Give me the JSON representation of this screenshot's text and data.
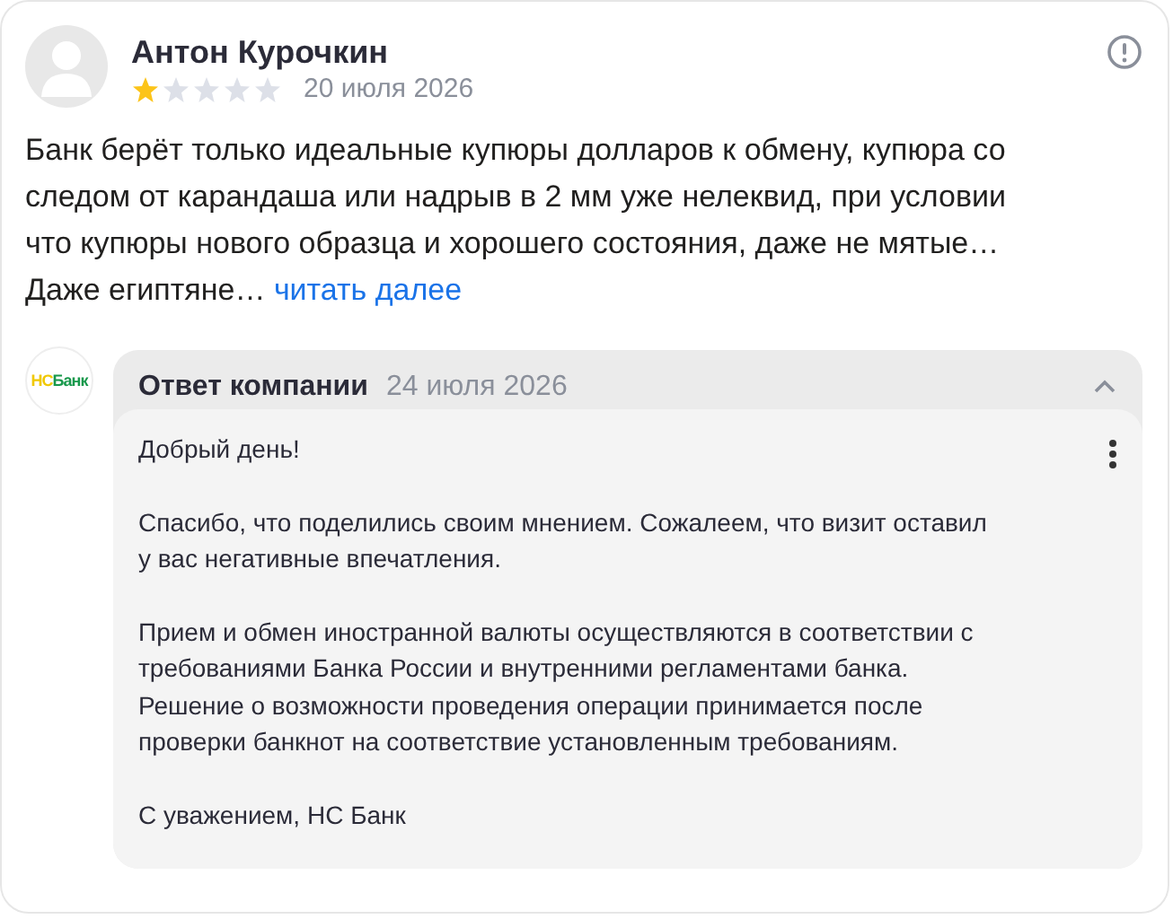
{
  "review": {
    "author": "Антон Курочкин",
    "stars": 1,
    "date": "20 июля 2026",
    "text": "Банк берёт только идеальные купюры долларов к обмену, купюра со\nследом от карандаша или надрыв в 2 мм уже нелеквид, при условии\nчто купюры нового образца и хорошего состояния, даже не мятые…\nДаже египтяне…",
    "more_link": "читать далее"
  },
  "reply": {
    "logo": {
      "part_1": "НС",
      "part_2": "Банк"
    },
    "title": "Ответ компании",
    "date": "24 июля 2026",
    "expanded": true,
    "paragraphs": [
      "Добрый день!",
      "Спасибо, что поделились своим мнением. Сожалеем, что визит оставил\nу вас негативные впечатления.",
      "Прием и обмен иностранной валюты осуществляются в соответствии с\nтребованиями Банка России и внутренними регламентами банка.\nРешение о возможности проведения операции принимается после\nпроверки банкнот на соответствие установленным требованиям.",
      "С уважением, НС Банк"
    ]
  }
}
